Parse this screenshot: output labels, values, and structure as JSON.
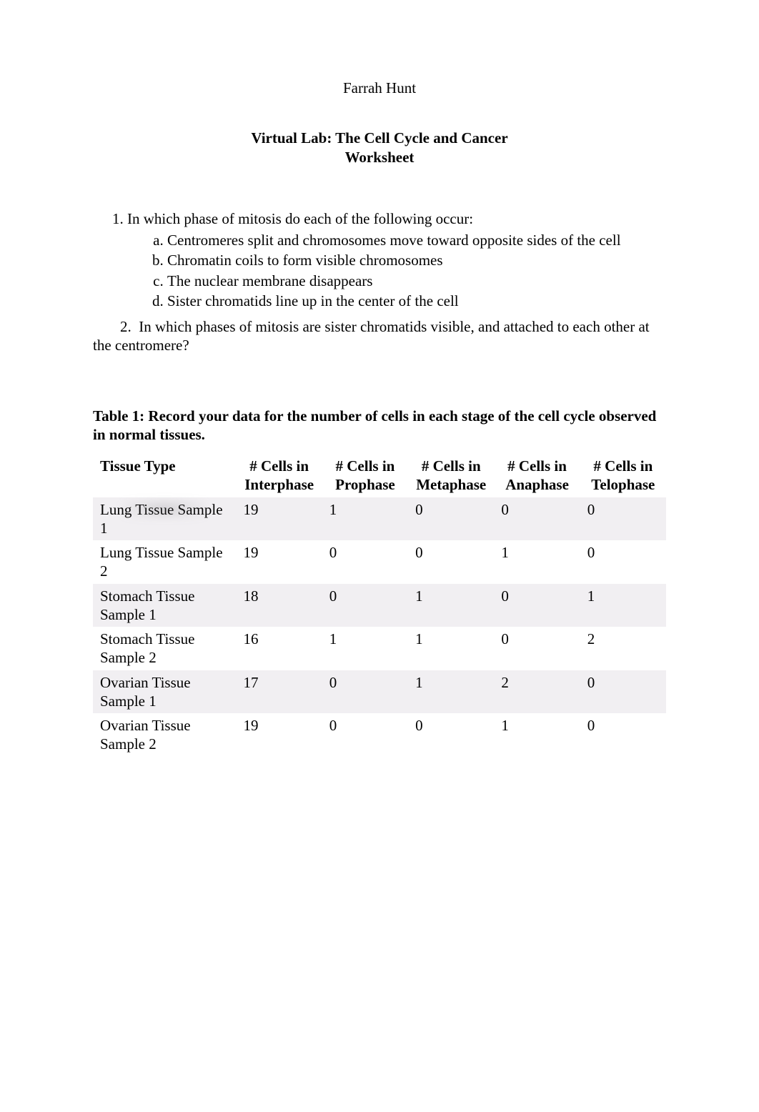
{
  "author": "Farrah Hunt",
  "doc_title": "Virtual Lab:  The Cell Cycle and Cancer",
  "doc_subtitle": "Worksheet",
  "q1": {
    "number": "1.",
    "text": "In which phase of mitosis do each of the following occur:",
    "items": [
      "Centromeres split and chromosomes move toward opposite sides of the cell",
      "Chromatin coils to form visible chromosomes",
      "The nuclear membrane disappears",
      "Sister chromatids line up in the center of the cell"
    ]
  },
  "q2": {
    "number": "2.",
    "text": "In which phases of mitosis are sister chromatids visible, and attached to each other at the centromere?"
  },
  "table1_heading": "Table 1:  Record your data for the number of cells in each stage of the cell cycle observed in normal tissues.",
  "table1": {
    "columns": [
      "Tissue Type",
      "# Cells in Interphase",
      "# Cells in Prophase",
      "# Cells in Metaphase",
      "# Cells in Anaphase",
      "# Cells in Telophase"
    ],
    "rows": [
      {
        "tissue": "Lung Tissue Sample 1",
        "interphase": "19",
        "prophase": "1",
        "metaphase": "0",
        "anaphase": "0",
        "telophase": "0"
      },
      {
        "tissue": "Lung Tissue Sample 2",
        "interphase": "19",
        "prophase": "0",
        "metaphase": "0",
        "anaphase": "1",
        "telophase": "0"
      },
      {
        "tissue": "Stomach Tissue Sample 1",
        "interphase": "18",
        "prophase": "0",
        "metaphase": "1",
        "anaphase": "0",
        "telophase": "1"
      },
      {
        "tissue": "Stomach Tissue Sample 2",
        "interphase": "16",
        "prophase": "1",
        "metaphase": "1",
        "anaphase": "0",
        "telophase": "2"
      },
      {
        "tissue": "Ovarian Tissue Sample 1",
        "interphase": "17",
        "prophase": "0",
        "metaphase": "1",
        "anaphase": "2",
        "telophase": "0"
      },
      {
        "tissue": "Ovarian Tissue Sample 2",
        "interphase": "19",
        "prophase": "0",
        "metaphase": "0",
        "anaphase": "1",
        "telophase": "0"
      }
    ]
  }
}
